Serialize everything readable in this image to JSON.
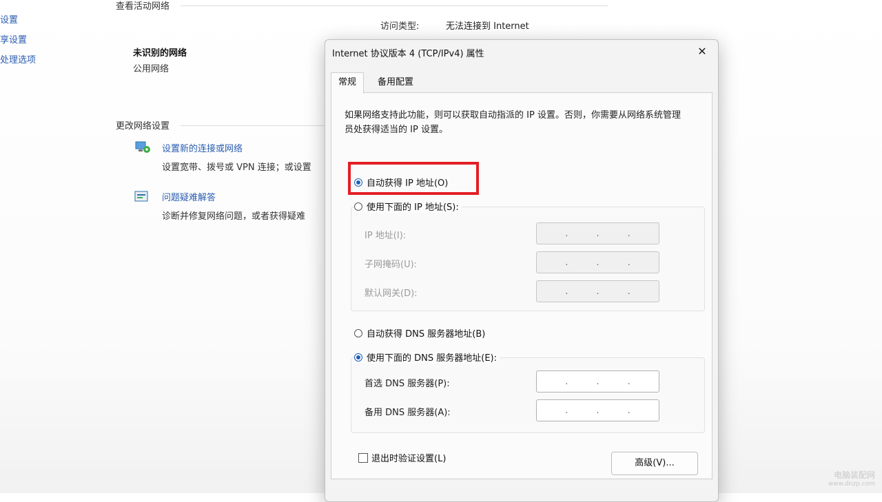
{
  "background": {
    "sidebar_links": [
      "更改适配器设置",
      "更改高级共享设置",
      "媒体流式处理选项"
    ],
    "sidebar_links_visible": [
      "设置",
      "享设置",
      "处理选项"
    ],
    "active_networks_heading": "查看活动网络",
    "network_name": "未识别的网络",
    "network_type": "公用网络",
    "access_type_label": "访问类型:",
    "access_type_value": "无法连接到 Internet",
    "change_settings_heading": "更改网络设置",
    "tasks": [
      {
        "title": "设置新的连接或网络",
        "desc": "设置宽带、拨号或 VPN 连接；或设置"
      },
      {
        "title": "问题疑难解答",
        "desc": "诊断并修复网络问题，或者获得疑难"
      }
    ]
  },
  "dialog": {
    "title": "Internet 协议版本 4 (TCP/IPv4) 属性",
    "tabs": [
      {
        "label": "常规"
      },
      {
        "label": "备用配置"
      }
    ],
    "description": "如果网络支持此功能，则可以获取自动指派的 IP 设置。否则，你需要从网络系统管理员处获得适当的 IP 设置。",
    "ip_auto_label": "自动获得 IP 地址(O)",
    "ip_manual_label": "使用下面的 IP 地址(S):",
    "ip_fields": [
      {
        "label": "IP 地址(I):"
      },
      {
        "label": "子网掩码(U):"
      },
      {
        "label": "默认网关(D):"
      }
    ],
    "dns_auto_label": "自动获得 DNS 服务器地址(B)",
    "dns_manual_label": "使用下面的 DNS 服务器地址(E):",
    "dns_fields": [
      {
        "label": "首选 DNS 服务器(P):"
      },
      {
        "label": "备用 DNS 服务器(A):"
      }
    ],
    "validate_label": "退出时验证设置(L)",
    "advanced_label": "高级(V)...",
    "close_glyph": "✕",
    "ip_auto_selected": true,
    "dns_manual_selected": true,
    "validate_checked": false
  },
  "watermark": {
    "title": "电脑装配网",
    "url": "www.dnzp.com"
  },
  "colors": {
    "highlight": "#e31e24",
    "link": "#2a5db0",
    "radio_accent": "#1f5fb5"
  }
}
